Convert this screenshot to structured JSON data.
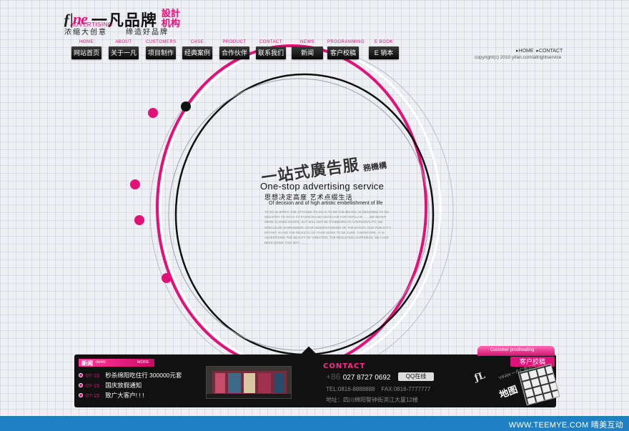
{
  "logo": {
    "mark": "ne",
    "mark_prefix": "ƒ|",
    "tagline": "ADVERTISING",
    "name": "一凡品牌",
    "design": "設計机构",
    "slogan_a": "浓缩大创意",
    "slogan_b": "缔造好品牌"
  },
  "nav": [
    {
      "en": "HOME",
      "cn": "网站首页"
    },
    {
      "en": "ABOUT",
      "cn": "关于一凡"
    },
    {
      "en": "CUSTOMERS",
      "cn": "项目制作"
    },
    {
      "en": "CASE",
      "cn": "经典案例"
    },
    {
      "en": "PRODUCT",
      "cn": "合作伙伴"
    },
    {
      "en": "CONTACT",
      "cn": "联系我们"
    },
    {
      "en": "NEWS",
      "cn": "新闻"
    },
    {
      "en": "PROGRAMMING",
      "cn": "客户校稿"
    },
    {
      "en": "E BOOK",
      "cn": "E 销本"
    }
  ],
  "toplinks": {
    "home": "HOME",
    "contact": "CONTACT"
  },
  "copyright": "copyright(c) 2010 yifan.com/allrightservice",
  "hero": {
    "title": "一站式廣告服",
    "title_sub": "務機構",
    "en": "One-stop advertising service",
    "cn": "思想决定高度  艺术点缀生活",
    "cn_en": "Of decision and of high artistic embellishment of life",
    "paragraph": "TO DO IS SPIRIT, THE ATTITUDE TO DO IS TO DO THE BRAND, IS DESIGNED TO DO INDUSTRY TO DO IS TO FASHION AND ADVOCATE FOR POPULAR ...... WE NEVER WERE CLOSED DOORS, BUT WILL NOT BE STUBBORN AS A PERSONALITY; WE SPECIALIZE IN BRANDING YOUR UNDERSTANDING OF THE INTENT; OUR PUBLICITY EFFORT IN AND THE RESULTS OF YOUR WORK TO BE SURE. THEREFORE, IT IS ADVERTISING THE BEAUTY OF CREATION, THE RESULTING HAPPINESS; WE HAVE BEEN DOING THIS WAY ......"
  },
  "news": {
    "title": "新闻",
    "title_en": "news",
    "more": "MORE",
    "items": [
      {
        "date": "07-15",
        "text": "秒杀绵阳吃住行  300000元套"
      },
      {
        "date": "07-15",
        "text": "国庆放假通知"
      },
      {
        "date": "07-15",
        "text": "致广大客户! ! !"
      }
    ]
  },
  "contact": {
    "title": "CONTACT",
    "country": "+86",
    "phone": "027 8727 0692",
    "qq": "QQ在线",
    "tel": "TEL:0816-8888888",
    "fax": "FAX:0816-7777777",
    "address": "地址：四川绵阳警钟街滨江大厦12楼"
  },
  "customer": {
    "tab": "Customer proofreading",
    "button": "客户校稿",
    "map": "地图",
    "map_tag": "YIFAN 一凡广告公司",
    "fan_logo": "ƒL"
  },
  "footer": "WWW.TEEMYE.COM  晴美互动",
  "colors": {
    "accent": "#e0127a",
    "footer": "#1f81c4",
    "bar": "#111111"
  }
}
